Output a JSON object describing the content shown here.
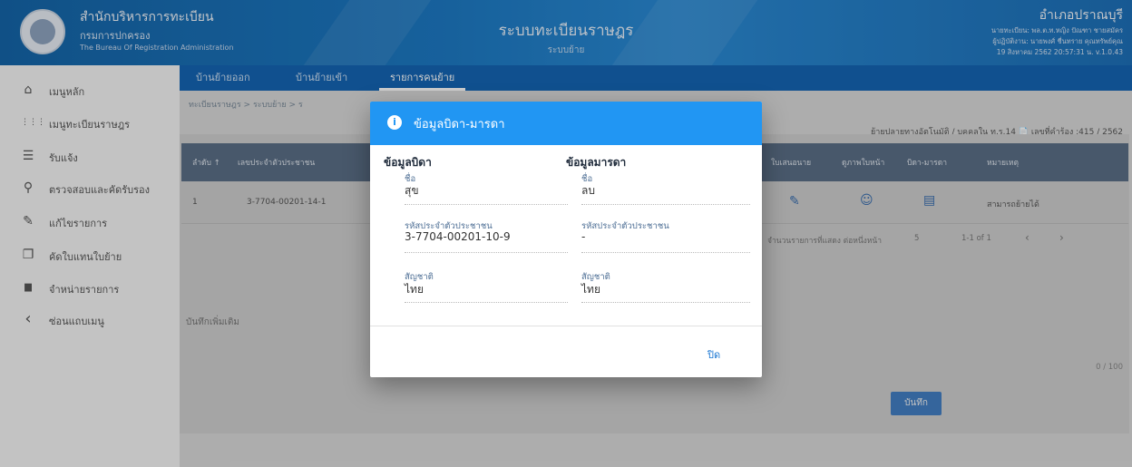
{
  "header": {
    "org_line1": "สำนักบริหารการทะเบียน",
    "org_line2": "กรมการปกครอง",
    "org_line3": "The Bureau Of Registration Administration",
    "system_title": "ระบบทะเบียนราษฎร",
    "system_subtitle": "ระบบย้าย",
    "office": "อำเภอปราณบุรี",
    "user_line1": "นายทะเบียน: พล.ต.ท.หญิง ปัณฑา ชายสมัคร",
    "user_line2": "ผู้ปฏิบัติงาน: นายพงศ์ ชื่นทราย คุณทรัพย์คุณ",
    "datetime_version": "19 สิงหาคม 2562 20:57:31 น.  v.1.0.43"
  },
  "sidebar": {
    "items": [
      {
        "icon": "home-icon",
        "glyph": "⌂",
        "label": "เมนูหลัก"
      },
      {
        "icon": "grid-icon",
        "glyph": "⋮⋮⋮",
        "label": "เมนูทะเบียนราษฎร"
      },
      {
        "icon": "list-icon",
        "glyph": "☰",
        "label": "รับแจ้ง"
      },
      {
        "icon": "search-icon",
        "glyph": "⚲",
        "label": "ตรวจสอบและคัดรับรอง"
      },
      {
        "icon": "edit-icon",
        "glyph": "✎",
        "label": "แก้ไขรายการ"
      },
      {
        "icon": "copy-icon",
        "glyph": "❐",
        "label": "คัดใบแทนใบย้าย"
      },
      {
        "icon": "trash-icon",
        "glyph": "▆",
        "label": "จำหน่ายรายการ"
      },
      {
        "icon": "chevron-left-icon",
        "glyph": "‹",
        "label": "ซ่อนแถบเมนู"
      }
    ]
  },
  "tabs": [
    {
      "label": "บ้านย้ายออก"
    },
    {
      "label": "บ้านย้ายเข้า"
    },
    {
      "label": "รายการคนย้าย"
    }
  ],
  "breadcrumb": "ทะเบียนราษฎร  >  ระบบย้าย  >  ร",
  "top_right_info": "ย้ายปลายทางอัตโนมัติ / บุคคลใน ท.ร.14  📄  เลขที่คำร้อง :415 / 2562",
  "table": {
    "headers_left": [
      "ลำดับ ↑",
      "เลขประจำตัวประชาชน"
    ],
    "headers_right": [
      "ใบเสนอนาย",
      "ดูภาพใบหน้า",
      "บิดา-มารดา",
      "หมายเหตุ"
    ],
    "row": {
      "index": "1",
      "pid": "3-7704-00201-14-1",
      "remark": "สามารถย้ายได้"
    },
    "pager_label": "จำนวนรายการที่แสดง ต่อหนึ่งหน้า",
    "pager_size": "5",
    "pager_range": "1-1 of 1"
  },
  "notes_label": "บันทึกเพิ่มเติม",
  "char_counter": "0 / 100",
  "save_label": "บันทึก",
  "modal": {
    "title": "ข้อมูลบิดา-มารดา",
    "father": {
      "section": "ข้อมูลบิดา",
      "name_label": "ชื่อ",
      "name": "สุข",
      "pid_label": "รหัสประจำตัวประชาชน",
      "pid": "3-7704-00201-10-9",
      "nationality_label": "สัญชาติ",
      "nationality": "ไทย"
    },
    "mother": {
      "section": "ข้อมูลมารดา",
      "name_label": "ชื่อ",
      "name": "ลบ",
      "pid_label": "รหัสประจำตัวประชาชน",
      "pid": "-",
      "nationality_label": "สัญชาติ",
      "nationality": "ไทย"
    },
    "close_label": "ปิด"
  }
}
